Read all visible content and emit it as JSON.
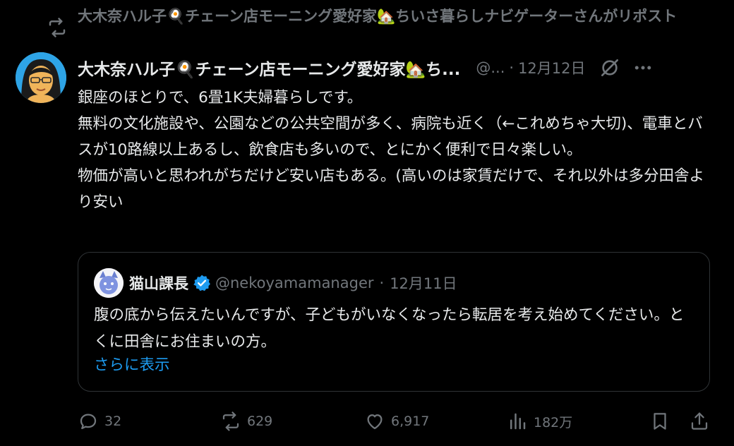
{
  "repost_banner": {
    "text": "大木奈ハル子🍳チェーン店モーニング愛好家🏡ちいさ暮らしナビゲーターさんがリポスト"
  },
  "post": {
    "display_name": "大木奈ハル子🍳チェーン店モーニング愛好家🏡ち...",
    "handle": "@...",
    "separator": "·",
    "date": "12月12日",
    "text": "銀座のほとりで、6畳1K夫婦暮らしです。\n無料の文化施設や、公園などの公共空間が多く、病院も近く（←これめちゃ大切)、電車とバスが10路線以上あるし、飲食店も多いので、とにかく便利で日々楽しい。\n物価が高いと思われがちだけど安い店もある。(高いのは家賃だけで、それ以外は多分田舎より安い"
  },
  "quote": {
    "name": "猫山課長",
    "handle": "@nekoyamamanager",
    "separator": "·",
    "date": "12月11日",
    "text": "腹の底から伝えたいんですが、子どもがいなくなったら転居を考え始めてください。とくに田舎にお住まいの方。",
    "show_more": "さらに表示"
  },
  "actions": {
    "replies": "32",
    "reposts": "629",
    "likes": "6,917",
    "views": "182万"
  },
  "colors": {
    "background": "#000000",
    "text": "#e7e9ea",
    "muted": "#71767b",
    "accent": "#1d9bf0",
    "border": "#2f3336"
  },
  "icons": {
    "repost_banner": "repost-icon",
    "grok": "grok-icon",
    "more": "more-icon",
    "verified": "verified-icon",
    "reply": "reply-icon",
    "repost": "repost-icon",
    "like": "heart-icon",
    "views": "views-icon",
    "bookmark": "bookmark-icon",
    "share": "share-icon"
  }
}
